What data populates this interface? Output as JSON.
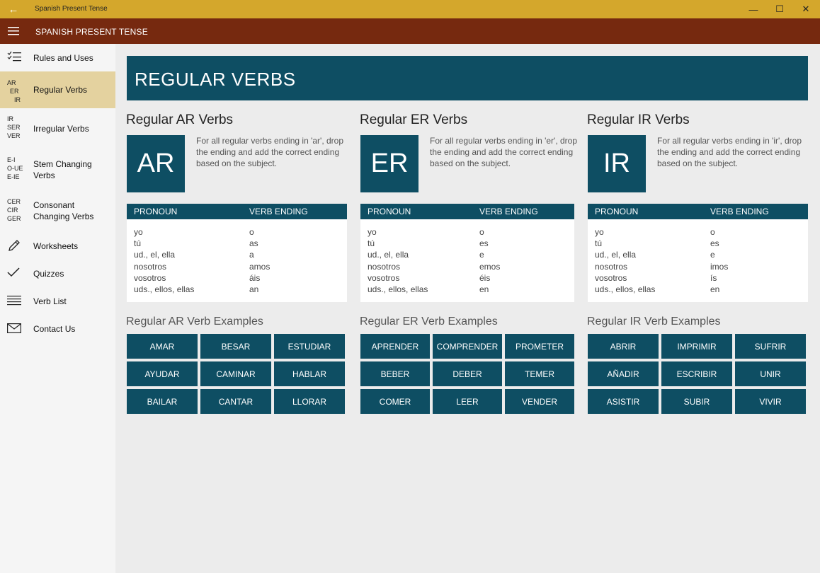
{
  "window": {
    "title": "Spanish Present Tense",
    "minimize": "—",
    "maximize": "☐",
    "close": "✕"
  },
  "appbar": {
    "title": "SPANISH PRESENT TENSE"
  },
  "sidebar": {
    "items": [
      {
        "label": "Rules and Uses",
        "icon": "checklist-icon"
      },
      {
        "label": "Regular Verbs",
        "icon_text": [
          "AR",
          "ER",
          "IR"
        ],
        "active": true
      },
      {
        "label": "Irregular Verbs",
        "icon_text": [
          "IR",
          "SER",
          "VER"
        ]
      },
      {
        "label": "Stem Changing Verbs",
        "icon_text": [
          "E-I",
          "O-UE",
          "E-IE"
        ]
      },
      {
        "label": "Consonant Changing Verbs",
        "icon_text": [
          "CER",
          "CIR",
          "GER"
        ]
      },
      {
        "label": "Worksheets",
        "icon": "pencil-icon"
      },
      {
        "label": "Quizzes",
        "icon": "checkmark-icon"
      },
      {
        "label": "Verb List",
        "icon": "list-icon"
      },
      {
        "label": "Contact Us",
        "icon": "mail-icon"
      }
    ]
  },
  "main": {
    "banner": "REGULAR VERBS",
    "columns": [
      {
        "heading": "Regular AR Verbs",
        "badge": "AR",
        "description": "For all regular verbs ending in 'ar', drop the ending and add the correct ending based on the subject.",
        "table_headers": [
          "PRONOUN",
          "VERB ENDING"
        ],
        "rows": [
          [
            "yo",
            "o"
          ],
          [
            "tú",
            "as"
          ],
          [
            "ud., el, ella",
            "a"
          ],
          [
            "nosotros",
            "amos"
          ],
          [
            "vosotros",
            "áis"
          ],
          [
            "uds., ellos, ellas",
            "an"
          ]
        ],
        "examples_heading": "Regular AR Verb Examples",
        "examples": [
          "AMAR",
          "BESAR",
          "ESTUDIAR",
          "AYUDAR",
          "CAMINAR",
          "HABLAR",
          "BAILAR",
          "CANTAR",
          "LLORAR"
        ]
      },
      {
        "heading": "Regular ER Verbs",
        "badge": "ER",
        "description": "For all regular verbs ending in 'er', drop the ending and add the correct ending based on the subject.",
        "table_headers": [
          "PRONOUN",
          "VERB ENDING"
        ],
        "rows": [
          [
            "yo",
            "o"
          ],
          [
            "tú",
            "es"
          ],
          [
            "ud., el, ella",
            "e"
          ],
          [
            "nosotros",
            "emos"
          ],
          [
            "vosotros",
            "éis"
          ],
          [
            "uds., ellos, ellas",
            "en"
          ]
        ],
        "examples_heading": "Regular ER Verb Examples",
        "examples": [
          "APRENDER",
          "COMPRENDER",
          "PROMETER",
          "BEBER",
          "DEBER",
          "TEMER",
          "COMER",
          "LEER",
          "VENDER"
        ]
      },
      {
        "heading": "Regular IR Verbs",
        "badge": "IR",
        "description": "For all regular verbs ending in 'ir', drop the ending and add the correct ending based on the subject.",
        "table_headers": [
          "PRONOUN",
          "VERB ENDING"
        ],
        "rows": [
          [
            "yo",
            "o"
          ],
          [
            "tú",
            "es"
          ],
          [
            "ud., el, ella",
            "e"
          ],
          [
            "nosotros",
            "imos"
          ],
          [
            "vosotros",
            "ís"
          ],
          [
            "uds., ellos, ellas",
            "en"
          ]
        ],
        "examples_heading": "Regular IR Verb Examples",
        "examples": [
          "ABRIR",
          "IMPRIMIR",
          "SUFRIR",
          "AÑADIR",
          "ESCRIBIR",
          "UNIR",
          "ASISTIR",
          "SUBIR",
          "VIVIR"
        ]
      }
    ]
  },
  "colors": {
    "titlebar": "#d4a72c",
    "appbar": "#76290f",
    "accent": "#0e4e63",
    "active_nav": "#e4d29f"
  }
}
